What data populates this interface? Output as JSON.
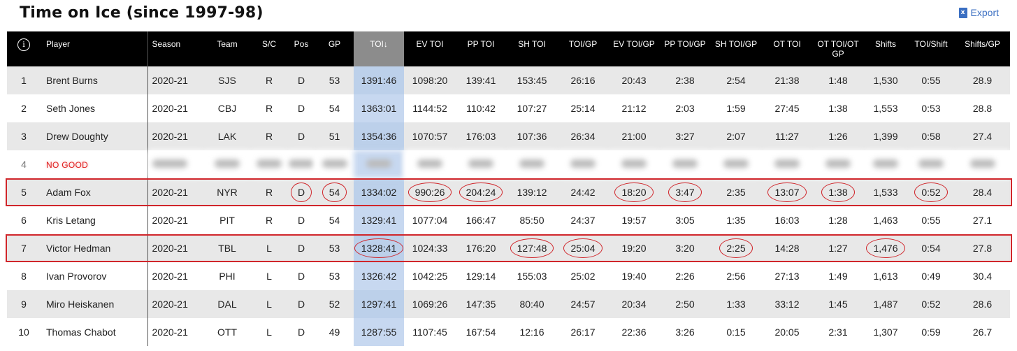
{
  "page": {
    "title": "Time on Ice (since 1997-98)",
    "export_label": "Export",
    "export_icon": "excel-icon"
  },
  "columns": [
    "",
    "Player",
    "Season",
    "Team",
    "S/C",
    "Pos",
    "GP",
    "TOI↓",
    "EV TOI",
    "PP TOI",
    "SH TOI",
    "TOI/GP",
    "EV TOI/GP",
    "PP TOI/GP",
    "SH TOI/GP",
    "OT TOI",
    "OT TOI/OT GP",
    "Shifts",
    "TOI/Shift",
    "Shifts/GP"
  ],
  "rows": [
    [
      "1",
      "Brent Burns",
      "2020-21",
      "SJS",
      "R",
      "D",
      "53",
      "1391:46",
      "1098:20",
      "139:41",
      "153:45",
      "26:16",
      "20:43",
      "2:38",
      "2:54",
      "21:38",
      "1:48",
      "1,530",
      "0:55",
      "28.9"
    ],
    [
      "2",
      "Seth Jones",
      "2020-21",
      "CBJ",
      "R",
      "D",
      "54",
      "1363:01",
      "1144:52",
      "110:42",
      "107:27",
      "25:14",
      "21:12",
      "2:03",
      "1:59",
      "27:45",
      "1:38",
      "1,553",
      "0:53",
      "28.8"
    ],
    [
      "3",
      "Drew Doughty",
      "2020-21",
      "LAK",
      "R",
      "D",
      "51",
      "1354:36",
      "1070:57",
      "176:03",
      "107:36",
      "26:34",
      "21:00",
      "3:27",
      "2:07",
      "11:27",
      "1:26",
      "1,399",
      "0:58",
      "27.4"
    ],
    [
      "4",
      "NO GOOD",
      "",
      "",
      "",
      "",
      "",
      "",
      "",
      "",
      "",
      "",
      "",
      "",
      "",
      "",
      "",
      "",
      "",
      ""
    ],
    [
      "5",
      "Adam Fox",
      "2020-21",
      "NYR",
      "R",
      "D",
      "54",
      "1334:02",
      "990:26",
      "204:24",
      "139:12",
      "24:42",
      "18:20",
      "3:47",
      "2:35",
      "13:07",
      "1:38",
      "1,533",
      "0:52",
      "28.4"
    ],
    [
      "6",
      "Kris Letang",
      "2020-21",
      "PIT",
      "R",
      "D",
      "54",
      "1329:41",
      "1077:04",
      "166:47",
      "85:50",
      "24:37",
      "19:57",
      "3:05",
      "1:35",
      "16:03",
      "1:28",
      "1,463",
      "0:55",
      "27.1"
    ],
    [
      "7",
      "Victor Hedman",
      "2020-21",
      "TBL",
      "L",
      "D",
      "53",
      "1328:41",
      "1024:33",
      "176:20",
      "127:48",
      "25:04",
      "19:20",
      "3:20",
      "2:25",
      "14:28",
      "1:27",
      "1,476",
      "0:54",
      "27.8"
    ],
    [
      "8",
      "Ivan Provorov",
      "2020-21",
      "PHI",
      "L",
      "D",
      "53",
      "1326:42",
      "1042:25",
      "129:14",
      "155:03",
      "25:02",
      "19:40",
      "2:26",
      "2:56",
      "27:13",
      "1:49",
      "1,613",
      "0:49",
      "30.4"
    ],
    [
      "9",
      "Miro Heiskanen",
      "2020-21",
      "DAL",
      "L",
      "D",
      "52",
      "1297:41",
      "1069:26",
      "147:35",
      "80:40",
      "24:57",
      "20:34",
      "2:50",
      "1:33",
      "33:12",
      "1:45",
      "1,487",
      "0:52",
      "28.6"
    ],
    [
      "10",
      "Thomas Chabot",
      "2020-21",
      "OTT",
      "L",
      "D",
      "49",
      "1287:55",
      "1107:45",
      "167:54",
      "12:16",
      "26:17",
      "22:36",
      "3:26",
      "0:15",
      "20:05",
      "2:31",
      "1,307",
      "0:59",
      "26.7"
    ]
  ],
  "circled_cells": {
    "5": [
      6,
      7,
      9,
      10,
      13,
      14,
      16,
      17,
      19
    ],
    "7": [
      8,
      11,
      12,
      15,
      18
    ]
  },
  "highlighted_rows": [
    "5",
    "7"
  ],
  "colors": {
    "circle": "#d0262b",
    "sorted_column": "#bcd0ea",
    "header_bg": "#000000",
    "export_link": "#3b6fc2"
  }
}
